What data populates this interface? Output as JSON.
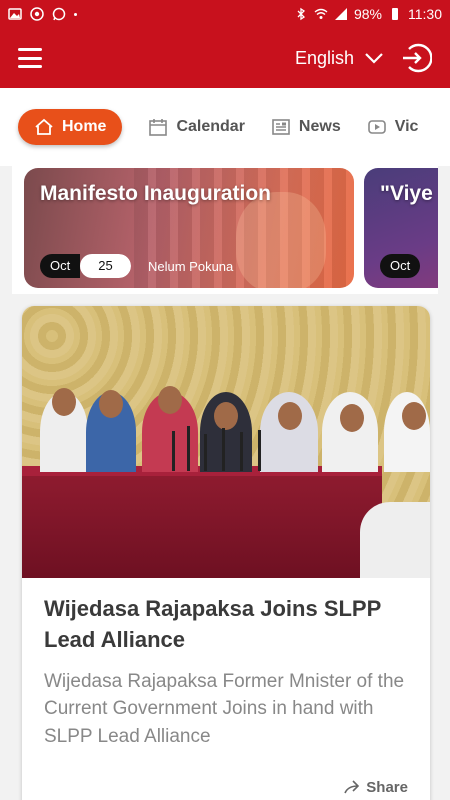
{
  "status_bar": {
    "battery": "98%",
    "time": "11:30"
  },
  "header": {
    "language": "English"
  },
  "tabs": [
    {
      "label": "Home",
      "icon": "home-icon",
      "active": true
    },
    {
      "label": "Calendar",
      "icon": "calendar-icon",
      "active": false
    },
    {
      "label": "News",
      "icon": "news-icon",
      "active": false
    },
    {
      "label": "Vic",
      "icon": "video-icon",
      "active": false
    }
  ],
  "events": [
    {
      "title": "Manifesto Inauguration",
      "month": "Oct",
      "day": "25",
      "place": "Nelum Pokuna"
    },
    {
      "title": "\"Viye",
      "month": "Oct",
      "day": "",
      "place": ""
    }
  ],
  "news": {
    "title": "Wijedasa Rajapaksa Joins SLPP Lead Alliance",
    "description": "Wijedasa Rajapaksa Former Mnister of the Current Government Joins in hand with SLPP Lead Alliance",
    "share_label": "Share"
  },
  "colors": {
    "brand_red": "#c8111d",
    "accent_orange": "#e8501a"
  }
}
